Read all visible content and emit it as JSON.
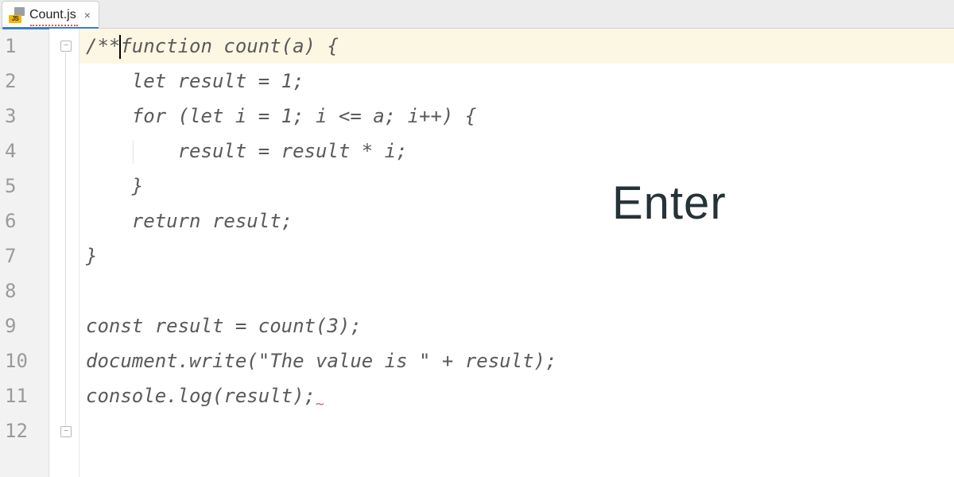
{
  "tab": {
    "icon_text": "JS",
    "filename": "Count.js",
    "close": "×"
  },
  "gutter": {
    "lines": [
      "1",
      "2",
      "3",
      "4",
      "5",
      "6",
      "7",
      "8",
      "9",
      "10",
      "11",
      "12"
    ]
  },
  "code": {
    "l1": "/**function count(a) {",
    "l2": "    let result = 1;",
    "l3": "    for (let i = 1; i <= a; i++) {",
    "l4": "        result = result * i;",
    "l5": "    }",
    "l6": "    return result;",
    "l7": "}",
    "l8": "",
    "l9": "const result = count(3);",
    "l10": "document.write(\"The value is \" + result);",
    "l11": "console.log(result);",
    "l12": ""
  },
  "overlay": {
    "key_hint": "Enter"
  },
  "fold": {
    "collapse": "−",
    "expand_alt": "⊟"
  },
  "squiggle": "~"
}
